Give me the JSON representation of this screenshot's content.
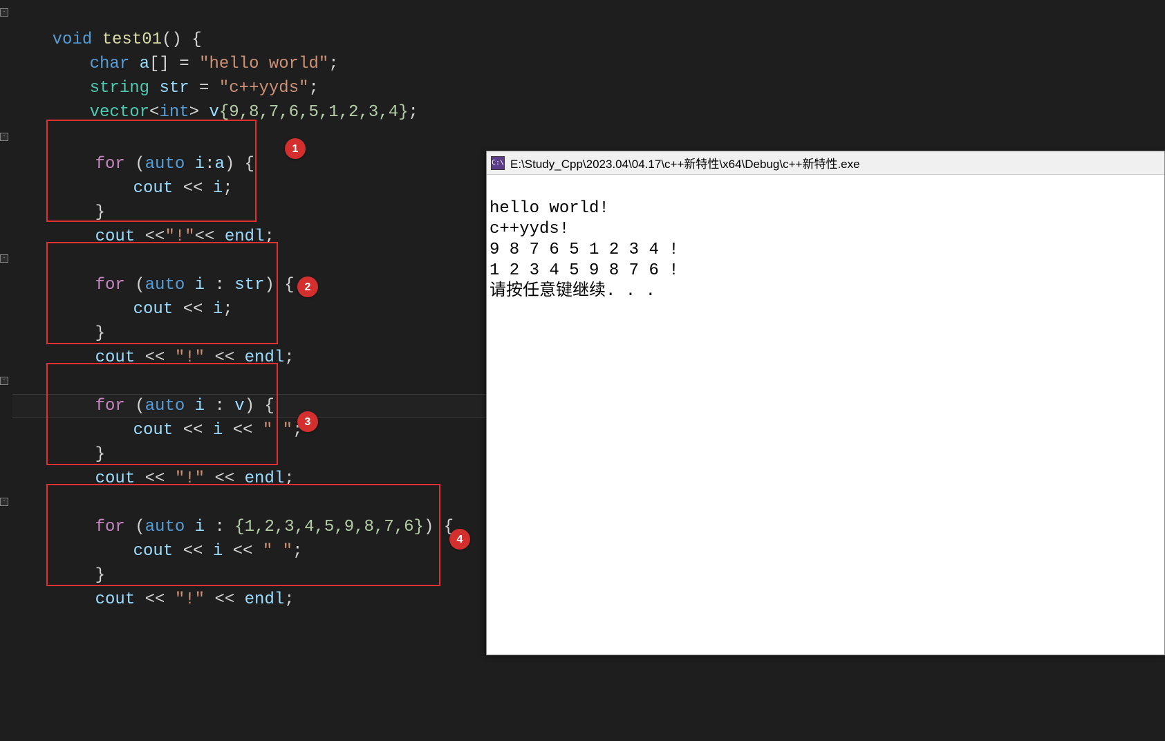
{
  "code": {
    "fn_sig": {
      "kw_void": "void",
      "name": "test01",
      "parens": "()",
      "brace": " {"
    },
    "decl1": {
      "type_char": "char",
      "var_a": "a",
      "brackets": "[]",
      "eq": " = ",
      "str": "\"hello world\"",
      "semi": ";"
    },
    "decl2": {
      "type_string": "string",
      "var_str": "str",
      "eq": " = ",
      "val": "\"c++yyds\"",
      "semi": ";"
    },
    "decl3": {
      "type_vector": "vector",
      "lt": "<",
      "type_int": "int",
      "gt": ">",
      "var_v": "v",
      "brace_init": "{9,8,7,6,5,1,2,3,4}",
      "semi": ";"
    },
    "block1": {
      "for_head": {
        "kw_for": "for",
        "open": " (",
        "kw_auto": "auto",
        "sp": " ",
        "var_i": "i",
        "colon": ":",
        "var_a": "a",
        "close": ") {"
      },
      "body": {
        "cout": "cout",
        "op": " << ",
        "var_i": "i",
        "semi": ";"
      },
      "close": "}",
      "after": {
        "cout": "cout",
        "op1": " <<",
        "str": "\"!\"",
        "op2": "<< ",
        "endl": "endl",
        "semi": ";"
      }
    },
    "block2": {
      "for_head": {
        "kw_for": "for",
        "open": " (",
        "kw_auto": "auto",
        "sp": " ",
        "var_i": "i",
        "colon": " : ",
        "var_str": "str",
        "close": ") {"
      },
      "body": {
        "cout": "cout",
        "op": " << ",
        "var_i": "i",
        "semi": ";"
      },
      "close": "}",
      "after": {
        "cout": "cout",
        "op1": " << ",
        "str": "\"!\"",
        "op2": " << ",
        "endl": "endl",
        "semi": ";"
      }
    },
    "block3": {
      "for_head": {
        "kw_for": "for",
        "open": " (",
        "kw_auto": "auto",
        "sp": " ",
        "var_i": "i",
        "colon": " : ",
        "var_v": "v",
        "close": ") {"
      },
      "body": {
        "cout": "cout",
        "op1": " << ",
        "var_i": "i",
        "op2": " << ",
        "str": "\" \"",
        "semi": ";"
      },
      "close": "}",
      "after": {
        "cout": "cout",
        "op1": " << ",
        "str": "\"!\"",
        "op2": " << ",
        "endl": "endl",
        "semi": ";"
      }
    },
    "block4": {
      "for_head": {
        "kw_for": "for",
        "open": " (",
        "kw_auto": "auto",
        "sp": " ",
        "var_i": "i",
        "colon": " : ",
        "list": "{1,2,3,4,5,9,8,7,6}",
        "close": ") {"
      },
      "body": {
        "cout": "cout",
        "op1": " << ",
        "var_i": "i",
        "op2": " << ",
        "str": "\" \"",
        "semi": ";"
      },
      "close": "}",
      "after": {
        "cout": "cout",
        "op1": " << ",
        "str": "\"!\"",
        "op2": " << ",
        "endl": "endl",
        "semi": ";"
      }
    }
  },
  "badges": {
    "b1": "1",
    "b2": "2",
    "b3": "3",
    "b4": "4"
  },
  "console": {
    "icon_text": "C:\\",
    "title": "E:\\Study_Cpp\\2023.04\\04.17\\c++新特性\\x64\\Debug\\c++新特性.exe",
    "lines": {
      "l1": "hello world!",
      "l2": "c++yyds!",
      "l3": "9 8 7 6 5 1 2 3 4 !",
      "l4": "1 2 3 4 5 9 8 7 6 !",
      "l5": "请按任意键继续. . ."
    }
  }
}
